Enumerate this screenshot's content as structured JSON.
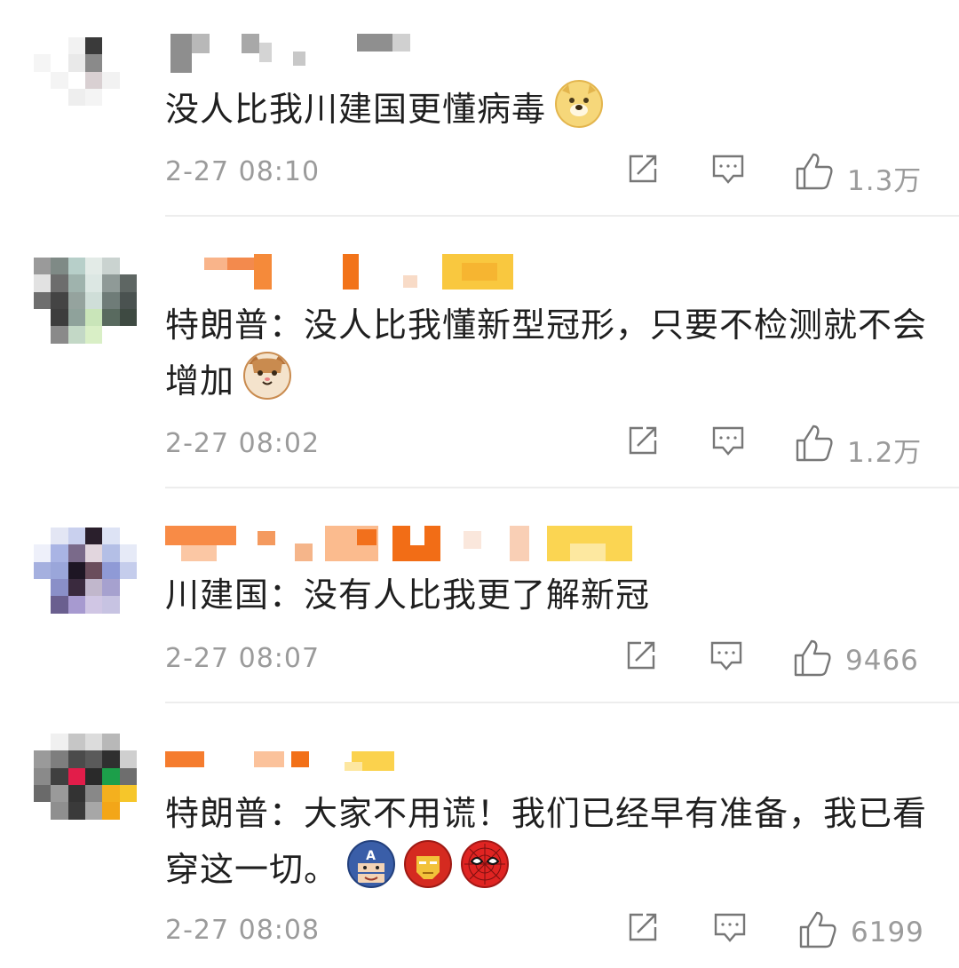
{
  "comments": [
    {
      "text": "没人比我川建国更懂病毒",
      "emoji": "doge-icon",
      "time": "2-27 08:10",
      "likes": "1.3万"
    },
    {
      "text": "特朗普：没人比我懂新型冠形，只要不检测就不会增加",
      "emoji": "cat-icon",
      "time": "2-27 08:02",
      "likes": "1.2万"
    },
    {
      "text": "川建国：没有人比我更了解新冠",
      "time": "2-27 08:07",
      "likes": "9466"
    },
    {
      "text": "特朗普：大家不用谎！我们已经早有准备，我已看穿这一切。",
      "emojis": [
        "captain-america-icon",
        "iron-man-icon",
        "spider-man-icon"
      ],
      "time": "2-27 08:08",
      "likes": "6199"
    }
  ],
  "colors": {
    "text": "#1f1f1f",
    "meta": "#9b9b9b",
    "divider": "#ededed",
    "username_orange": "#f6822b",
    "username_yellow": "#f8c940"
  }
}
